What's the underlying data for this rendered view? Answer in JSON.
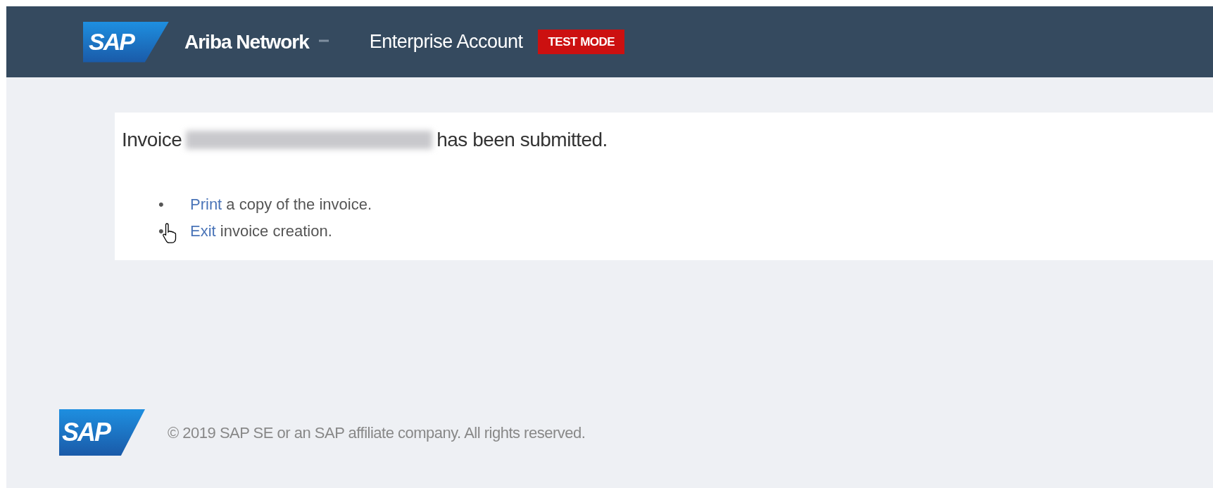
{
  "header": {
    "logo": "SAP",
    "product": "Ariba Network",
    "account": "Enterprise Account",
    "mode_badge": "TEST MODE"
  },
  "message": {
    "before": "Invoice",
    "after": "has been submitted.",
    "redacted": true
  },
  "actions": [
    {
      "bullet": "•",
      "link": "Print",
      "text": " a copy of the invoice."
    },
    {
      "bullet": "•",
      "link": "Exit",
      "text": " invoice creation.",
      "hovered": true
    }
  ],
  "footer": {
    "logo": "SAP",
    "copyright": "© 2019 SAP SE or an SAP affiliate company. All rights reserved."
  }
}
